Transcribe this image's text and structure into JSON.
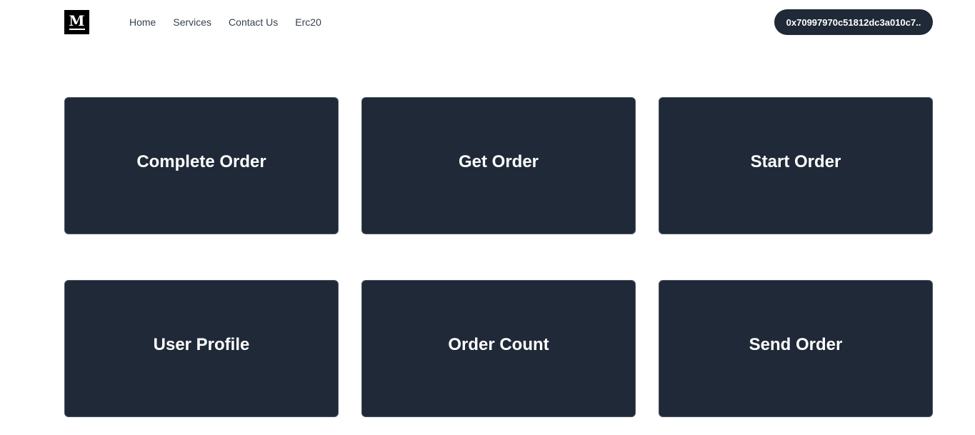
{
  "logo": {
    "letter": "M"
  },
  "nav": {
    "links": [
      "Home",
      "Services",
      "Contact Us",
      "Erc20"
    ]
  },
  "wallet": {
    "address": "0x70997970c51812dc3a010c7.."
  },
  "cards": [
    {
      "label": "Complete Order"
    },
    {
      "label": "Get Order"
    },
    {
      "label": "Start Order"
    },
    {
      "label": "User Profile"
    },
    {
      "label": "Order Count"
    },
    {
      "label": "Send Order"
    }
  ],
  "colors": {
    "card_bg": "#1f2937",
    "wallet_bg": "#1f2937",
    "text_on_dark": "#ffffff"
  }
}
